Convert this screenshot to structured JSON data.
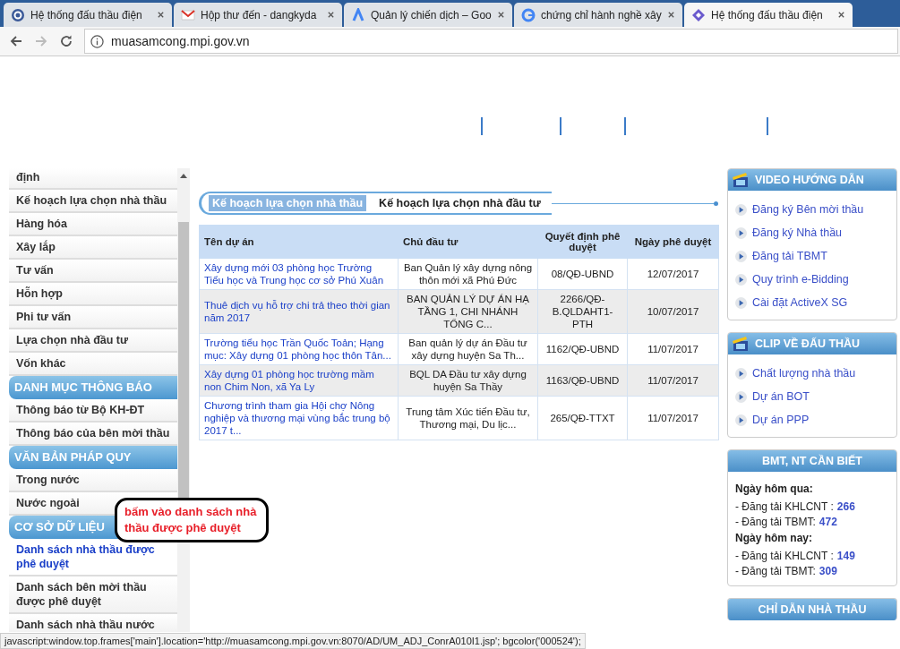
{
  "browser": {
    "tabs": [
      {
        "title": "Hệ thống đấu thầu điện",
        "selected": false
      },
      {
        "title": "Hộp thư đến - dangkyda",
        "selected": false
      },
      {
        "title": "Quản lý chiến dịch – Goo",
        "selected": false
      },
      {
        "title": "chứng chỉ hành nghề xây",
        "selected": false
      },
      {
        "title": "Hệ thống đấu thầu điện",
        "selected": true
      }
    ],
    "url": "muasamcong.mpi.gov.vn"
  },
  "sidebar": [
    {
      "kind": "item",
      "label": "định",
      "selected": false
    },
    {
      "kind": "item",
      "label": "Kế hoạch lựa chọn nhà thầu",
      "selected": false
    },
    {
      "kind": "item",
      "label": "Hàng hóa",
      "selected": false
    },
    {
      "kind": "item",
      "label": "Xây lắp",
      "selected": false
    },
    {
      "kind": "item",
      "label": "Tư vấn",
      "selected": false
    },
    {
      "kind": "item",
      "label": "Hỗn hợp",
      "selected": false
    },
    {
      "kind": "item",
      "label": "Phi tư vấn",
      "selected": false
    },
    {
      "kind": "item",
      "label": "Lựa chọn nhà đầu tư",
      "selected": false
    },
    {
      "kind": "item",
      "label": "Vốn khác",
      "selected": false
    },
    {
      "kind": "header",
      "label": "DANH MỤC THÔNG BÁO"
    },
    {
      "kind": "item",
      "label": "Thông báo từ Bộ KH-ĐT",
      "selected": false
    },
    {
      "kind": "item",
      "label": "Thông báo của bên mời thầu",
      "selected": false
    },
    {
      "kind": "header",
      "label": "VĂN BẢN PHÁP QUY"
    },
    {
      "kind": "item",
      "label": "Trong nước",
      "selected": false
    },
    {
      "kind": "item",
      "label": "Nước ngoài",
      "selected": false
    },
    {
      "kind": "header",
      "label": "CƠ SỞ DỮ LIỆU"
    },
    {
      "kind": "item",
      "label": "Danh sách nhà thầu được phê duyệt",
      "selected": true
    },
    {
      "kind": "item",
      "label": "Danh sách bên mời thầu được phê duyệt",
      "selected": false
    },
    {
      "kind": "item",
      "label": "Danh sách nhà thầu nước",
      "selected": false
    }
  ],
  "callout": "bấm vào danh sách nhà thầu được phê duyệt",
  "content_tabs": [
    {
      "label": "Kế hoạch lựa chọn nhà thầu",
      "selected": true
    },
    {
      "label": "Kế hoạch lựa chọn nhà đầu tư",
      "selected": false
    }
  ],
  "table": {
    "columns": [
      "Tên dự án",
      "Chủ đầu tư",
      "Quyết định phê duyệt",
      "Ngày phê duyệt"
    ],
    "rows": [
      [
        "Xây dựng mới 03 phòng học Trường Tiểu học và Trung học cơ sở Phú Xuân",
        "Ban Quản lý xây dựng nông thôn mới xã Phú Đức",
        "08/QĐ-UBND",
        "12/07/2017"
      ],
      [
        "Thuê dịch vụ hỗ trợ chi trả theo thời gian năm 2017",
        "BAN QUẢN LÝ DỰ ÁN HẠ TẦNG 1, CHI NHÁNH TỔNG C...",
        "2266/QĐ-B.QLDAHT1-PTH",
        "10/07/2017"
      ],
      [
        "Trường tiểu học Trần Quốc Toản; Hạng mục: Xây dựng 01 phòng học thôn Tân...",
        "Ban quản lý dự án Đầu tư xây dựng huyện Sa Th...",
        "1162/QĐ-UBND",
        "11/07/2017"
      ],
      [
        "Xây dựng 01 phòng học trường mầm non Chim Non, xã Ya Ly",
        "BQL DA Đầu tư xây dựng huyện Sa Thầy",
        "1163/QĐ-UBND",
        "11/07/2017"
      ],
      [
        "Chương trình tham gia Hội chợ Nông nghiệp và thương mại vùng bắc trung bộ 2017 t...",
        "Trung tâm Xúc tiến Đầu tư, Thương mại, Du lịc...",
        "265/QĐ-TTXT",
        "11/07/2017"
      ]
    ]
  },
  "right_panels": [
    {
      "kind": "links",
      "title": "VIDEO HƯỚNG DẪN",
      "links": [
        "Đăng ký Bên mời thầu",
        "Đăng ký Nhà thầu",
        "Đăng tải TBMT",
        "Quy trình e-Bidding",
        "Cài đặt ActiveX SG"
      ]
    },
    {
      "kind": "links",
      "title": "CLIP VỀ ĐẤU THẦU",
      "links": [
        "Chất lượng nhà thầu",
        "Dự án BOT",
        "Dự án PPP"
      ]
    },
    {
      "kind": "stats",
      "title": "BMT, NT CẦN BIẾT",
      "groups": [
        {
          "heading": "Ngày hôm qua:",
          "lines": [
            {
              "label": "- Đăng tải KHLCNT :",
              "value": "266"
            },
            {
              "label": "- Đăng tải TBMT:",
              "value": "472"
            }
          ]
        },
        {
          "heading": "Ngày hôm nay:",
          "lines": [
            {
              "label": "- Đăng tải KHLCNT :",
              "value": "149"
            },
            {
              "label": "- Đăng tải TBMT:",
              "value": "309"
            }
          ]
        }
      ]
    },
    {
      "kind": "header_only",
      "title": "CHỈ DẪN NHÀ THẦU"
    }
  ],
  "status_bar": "javascript:window.top.frames['main'].location='http://muasamcong.mpi.gov.vn:8070/AD/UM_ADJ_ConrA010I1.jsp'; bgcolor('000524');"
}
